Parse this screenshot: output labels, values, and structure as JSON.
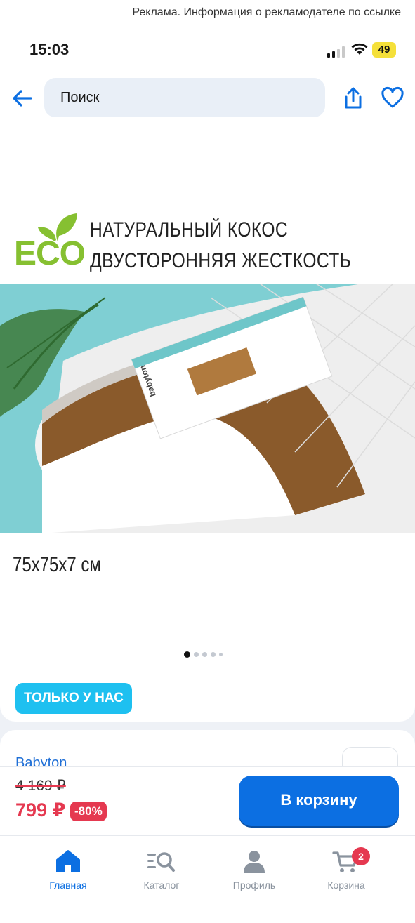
{
  "ad_banner": "Реклама. Информация о рекламодателе по ссылке",
  "status_bar": {
    "time": "15:03",
    "battery": "49"
  },
  "header": {
    "search_placeholder": "Поиск"
  },
  "product": {
    "image_text": {
      "eco": "ECO",
      "line1": "НАТУРАЛЬНЫЙ КОКОС",
      "line2": "ДВУСТОРОННЯЯ ЖЕСТКОСТЬ",
      "size": "75x75x7 см",
      "package_brand": "babyton"
    },
    "gallery": {
      "total": 5,
      "active_index": 0
    },
    "promo_badge": "ТОЛЬКО У НАС",
    "brand": "Babyton",
    "old_price": "4 169 ₽",
    "price": "799 ₽",
    "discount": "-80%",
    "add_to_cart": "В корзину"
  },
  "tabs": [
    {
      "label": "Главная",
      "icon": "home-icon",
      "active": true
    },
    {
      "label": "Каталог",
      "icon": "catalog-search-icon",
      "active": false
    },
    {
      "label": "Профиль",
      "icon": "profile-icon",
      "active": false
    },
    {
      "label": "Корзина",
      "icon": "cart-icon",
      "active": false,
      "badge": "2"
    }
  ],
  "colors": {
    "accent": "#0c6fe2",
    "sale": "#e53950",
    "promo": "#1ec0f0",
    "eco_green": "#86c031"
  }
}
